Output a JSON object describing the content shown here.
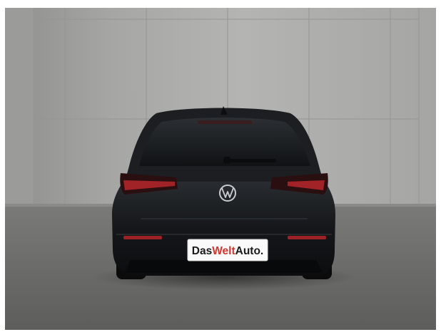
{
  "photo": {
    "subject": "car-rear-view",
    "colors": {
      "wall": "#a9a9a7",
      "floor": "#6c6c6a",
      "car_body": "#17191c",
      "taillight": "#c0282c",
      "plate_bg": "#fafafa",
      "brand_red": "#d4362e",
      "text_dark": "#1b1b1b"
    }
  },
  "license_plate": {
    "part1": "Das",
    "part2": "Welt",
    "part3": "Auto."
  },
  "badge": {
    "icon": "vw-logo-icon"
  }
}
